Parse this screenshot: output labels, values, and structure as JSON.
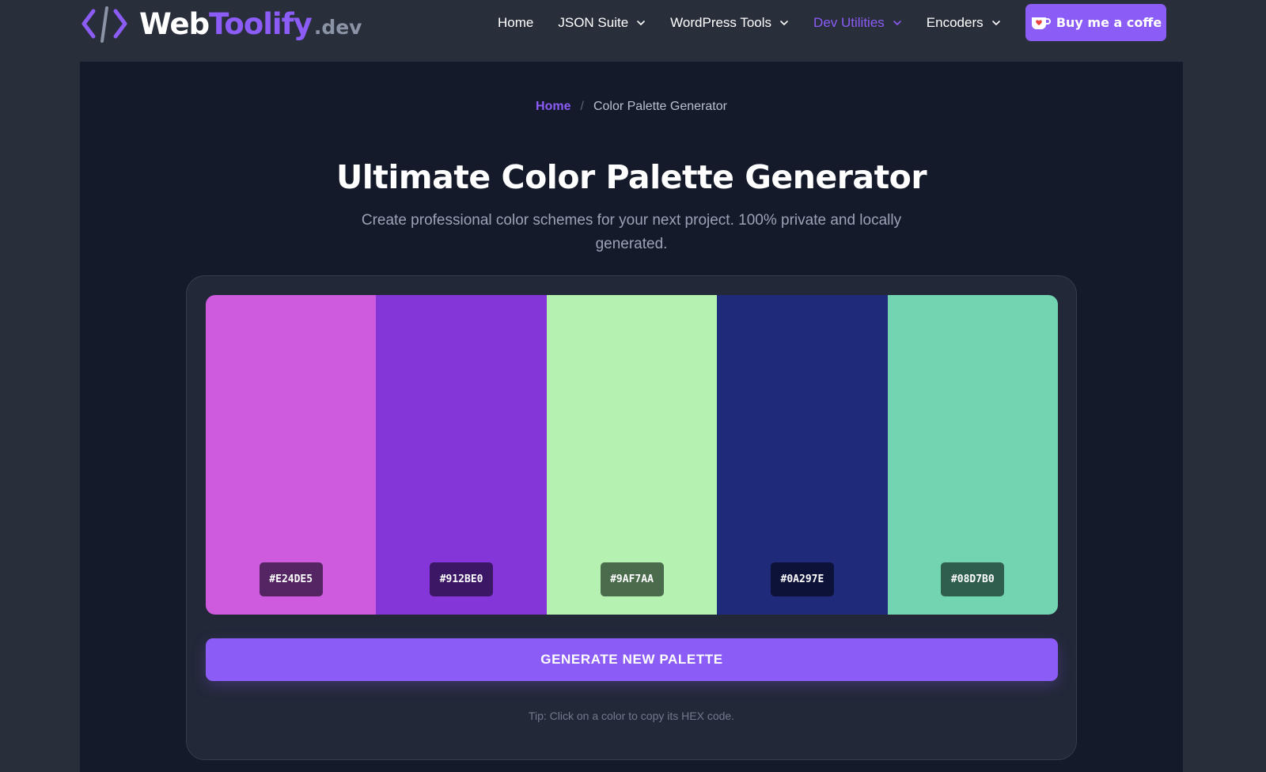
{
  "header": {
    "logo": {
      "word1": "Web",
      "word2": "Toolify",
      "tld": ".dev",
      "icon": "code-brackets-icon"
    },
    "nav": [
      {
        "label": "Home",
        "dropdown": false,
        "active": false
      },
      {
        "label": "JSON Suite",
        "dropdown": true,
        "active": false
      },
      {
        "label": "WordPress Tools",
        "dropdown": true,
        "active": false
      },
      {
        "label": "Dev Utilities",
        "dropdown": true,
        "active": true
      },
      {
        "label": "Encoders",
        "dropdown": true,
        "active": false
      }
    ],
    "coffee_button": {
      "label": "Buy me a coffe",
      "icon": "coffee-cup-icon"
    }
  },
  "breadcrumb": {
    "home": "Home",
    "separator": "/",
    "current": "Color Palette Generator"
  },
  "page": {
    "title": "Ultimate Color Palette Generator",
    "subtitle": "Create professional color schemes for your next project. 100% private and locally generated."
  },
  "palette": {
    "swatches": [
      {
        "hex": "#E24DE5",
        "display": "#ce5bde",
        "label_bg": "#552463"
      },
      {
        "hex": "#912BE0",
        "display": "#8536d9",
        "label_bg": "#3b1766"
      },
      {
        "hex": "#9AF7AA",
        "display": "#b5f2b1",
        "label_bg": "#4a6b4c"
      },
      {
        "hex": "#0A297E",
        "display": "#1f2a7a",
        "label_bg": "#0d1238"
      },
      {
        "hex": "#08D7B0",
        "display": "#72d4b0",
        "label_bg": "#2f5e4e"
      }
    ]
  },
  "generate_button": "GENERATE NEW PALETTE",
  "tip": "Tip: Click on a color to copy its HEX code.",
  "colors": {
    "accent": "#8b5cf6",
    "header_bg": "#292e3b",
    "main_bg": "#151a2b",
    "card_bg": "#222838"
  }
}
